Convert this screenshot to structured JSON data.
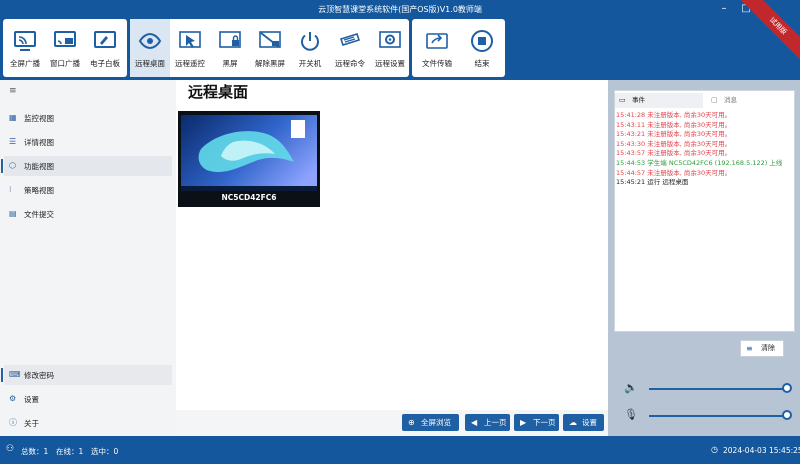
{
  "window": {
    "title": "云顶智慧课堂系统软件(国产OS版)V1.0教师端",
    "ribbon": "试用版"
  },
  "toolbar": {
    "items": [
      {
        "label": "全屏广播",
        "icon": "fullscreen-broadcast-icon"
      },
      {
        "label": "窗口广播",
        "icon": "window-broadcast-icon"
      },
      {
        "label": "电子白板",
        "icon": "whiteboard-icon"
      },
      {
        "label": "远程桌面",
        "icon": "eye-icon",
        "active": true
      },
      {
        "label": "远程遥控",
        "icon": "cursor-icon"
      },
      {
        "label": "黑屏",
        "icon": "lock-icon"
      },
      {
        "label": "解除黑屏",
        "icon": "unlock-screen-icon"
      },
      {
        "label": "开关机",
        "icon": "power-icon"
      },
      {
        "label": "远程命令",
        "icon": "command-icon"
      },
      {
        "label": "远程设置",
        "icon": "settings-icon"
      },
      {
        "label": "文件传输",
        "icon": "file-transfer-icon"
      },
      {
        "label": "结束",
        "icon": "stop-icon"
      }
    ]
  },
  "sidebar": {
    "items": [
      {
        "label": "监控视图",
        "icon": "grid-icon"
      },
      {
        "label": "详情视图",
        "icon": "list-icon"
      },
      {
        "label": "功能视图",
        "icon": "cube-icon",
        "active": true
      },
      {
        "label": "策略视图",
        "icon": "strategy-icon"
      },
      {
        "label": "文件提交",
        "icon": "file-icon"
      }
    ],
    "bottom": [
      {
        "label": "修改密码",
        "icon": "keyboard-icon"
      },
      {
        "label": "设置",
        "icon": "gear-icon"
      },
      {
        "label": "关于",
        "icon": "info-icon"
      }
    ]
  },
  "main": {
    "heading": "远程桌面",
    "device": {
      "name": "NC5CD42FC6"
    },
    "buttons": [
      {
        "label": "全屏浏览",
        "icon": "fullscreen-icon"
      },
      {
        "label": "上一页",
        "icon": "prev-icon"
      },
      {
        "label": "下一页",
        "icon": "next-icon"
      },
      {
        "label": "设置",
        "icon": "settings-cloud-icon"
      }
    ]
  },
  "log": {
    "tabs": [
      "事件",
      "消息"
    ],
    "lines": [
      {
        "text": "15:41:28 未注册版本, 尚余30天可用。",
        "color": "#e0444b"
      },
      {
        "text": "15:43:11 未注册版本, 尚余30天可用。",
        "color": "#e0444b"
      },
      {
        "text": "15:43:21 未注册版本, 尚余30天可用。",
        "color": "#e0444b"
      },
      {
        "text": "15:43:30 未注册版本, 尚余30天可用。",
        "color": "#e0444b"
      },
      {
        "text": "15:43:57 未注册版本, 尚余30天可用。",
        "color": "#e0444b"
      },
      {
        "text": "15:44:53 学生端 NC5CD42FC6 (192.168.5.122) 上线",
        "color": "#2e9a3a"
      },
      {
        "text": "15:44:57 未注册版本, 尚余30天可用。",
        "color": "#e0444b"
      },
      {
        "text": "15:45:21 运行 远程桌面",
        "color": "#222222"
      }
    ],
    "clear_label": "清除"
  },
  "controls": {
    "volume_level": 1.0,
    "mic_level": 1.0
  },
  "status": {
    "total": "总数：1",
    "online": "在线：1",
    "selected": "选中：0",
    "datetime": "2024-04-03 15:45:25"
  }
}
